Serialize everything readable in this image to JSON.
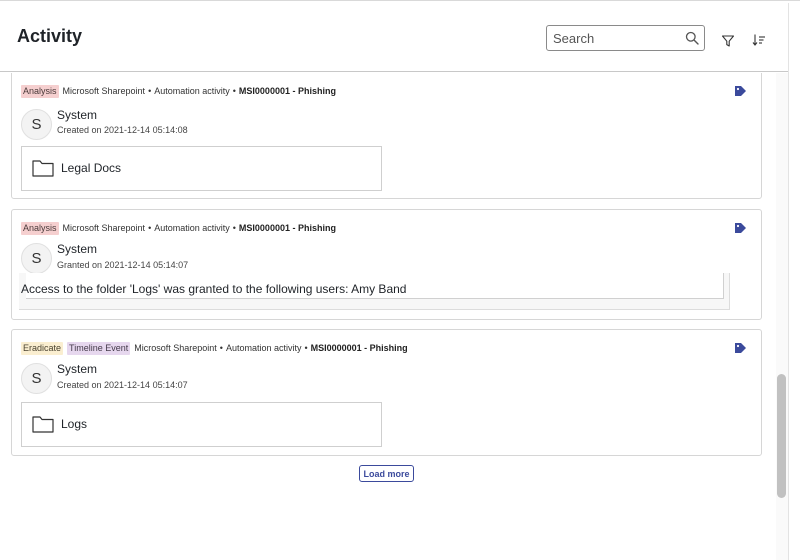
{
  "header": {
    "title": "Activity",
    "search": {
      "placeholder": "Search",
      "value": ""
    },
    "filter_icon": "filter-icon",
    "sort_icon": "sort-icon"
  },
  "activities": [
    {
      "tags": [
        {
          "label": "Analysis",
          "color": "#f5cfcf"
        }
      ],
      "source": "Microsoft Sharepoint",
      "sep1": "•",
      "type": "Automation activity",
      "sep2": "•",
      "incident": "MSI0000001 - Phishing",
      "avatar": "S",
      "author": "System",
      "timestamp": "Created on 2021-12-14 05:14:08",
      "folder": "Legal Docs"
    },
    {
      "tags": [
        {
          "label": "Analysis",
          "color": "#f5cfcf"
        }
      ],
      "source": "Microsoft Sharepoint",
      "sep1": "•",
      "type": "Automation activity",
      "sep2": "•",
      "incident": "MSI0000001 - Phishing",
      "avatar": "S",
      "author": "System",
      "timestamp": "Granted on 2021-12-14 05:14:07",
      "message": "Access to the folder 'Logs' was granted to the following users: Amy Band"
    },
    {
      "tags": [
        {
          "label": "Eradicate",
          "color": "#faeed0"
        },
        {
          "label": "Timeline Event",
          "color": "#e6d7ee"
        }
      ],
      "source": "Microsoft Sharepoint",
      "sep1": "•",
      "type": "Automation activity",
      "sep2": "•",
      "incident": "MSI0000001 - Phishing",
      "avatar": "S",
      "author": "System",
      "timestamp": "Created on 2021-12-14 05:14:07",
      "folder": "Logs"
    }
  ],
  "load_more_label": "Load more",
  "colors": {
    "accent": "#3b4a9c",
    "tag_icon": "#3b4a9c"
  }
}
